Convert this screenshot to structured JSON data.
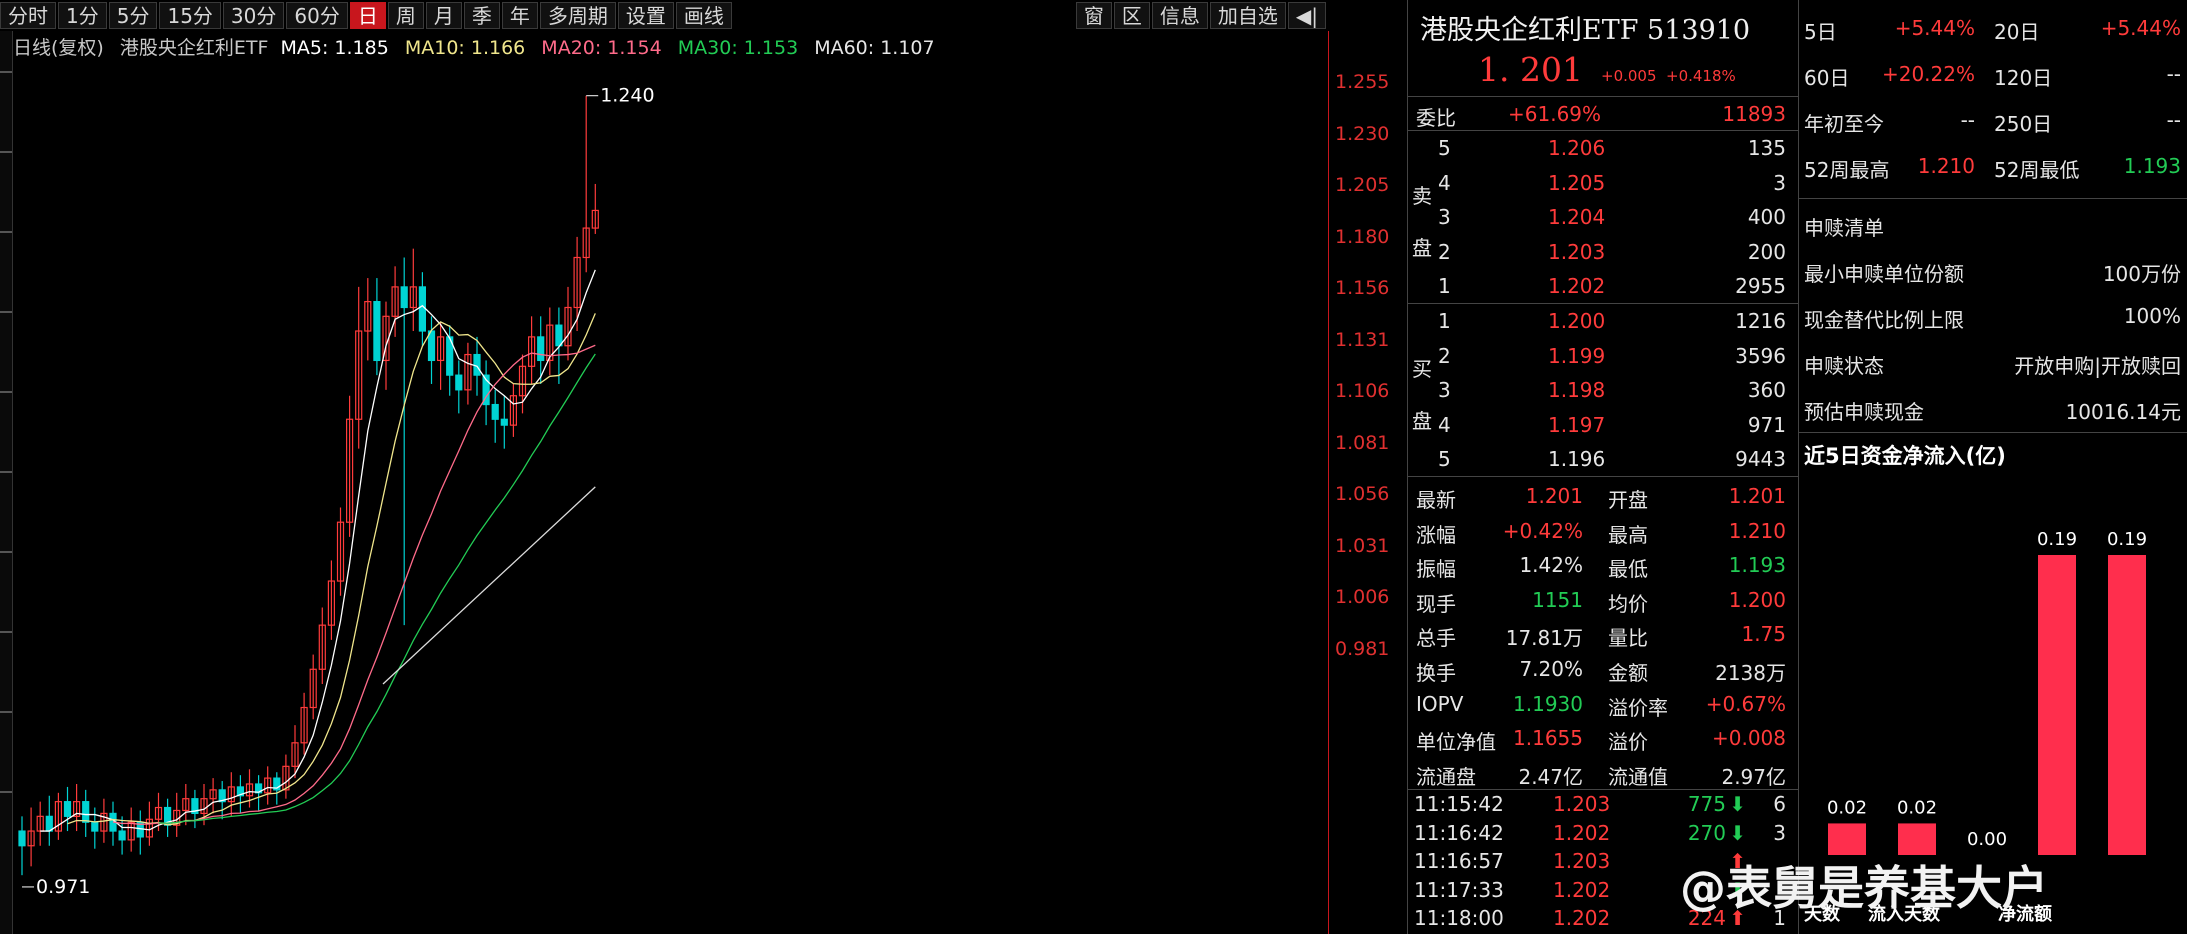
{
  "toolbar": {
    "periods": [
      "分时",
      "1分",
      "5分",
      "15分",
      "30分",
      "60分",
      "日",
      "周",
      "月",
      "季",
      "年",
      "多周期",
      "设置",
      "画线"
    ],
    "active_period": "日",
    "right_items": [
      "窗",
      "区",
      "信息",
      "加自选"
    ]
  },
  "chart": {
    "title": "日线(复权)",
    "name": "港股央企红利ETF",
    "ma5": "MA5: 1.185",
    "ma10": "MA10: 1.166",
    "ma20": "MA20: 1.154",
    "ma30": "MA30: 1.153",
    "ma60": "MA60: 1.107",
    "high_marker": "1.240",
    "low_marker": "0.971",
    "price_ticks": [
      "1.255",
      "1.230",
      "1.205",
      "1.180",
      "1.156",
      "1.131",
      "1.106",
      "1.081",
      "1.056",
      "1.031",
      "1.006",
      "0.981"
    ],
    "colors": {
      "up": "#ff3b3b",
      "down": "#00d4d4",
      "ma5": "#ffffff",
      "ma10": "#f0e68c",
      "ma20": "#ff6b8a",
      "ma30": "#22cc55",
      "ma60": "#dcdcdc"
    }
  },
  "chart_data": {
    "type": "candlestick",
    "title": "港股央企红利ETF 日线(复权)",
    "ylim": [
      0.96,
      1.26
    ],
    "candles": [
      [
        0.99,
        0.985,
        0.995,
        0.975
      ],
      [
        0.985,
        0.99,
        0.998,
        0.978
      ],
      [
        0.99,
        0.995,
        1.0,
        0.985
      ],
      [
        0.995,
        0.99,
        1.002,
        0.985
      ],
      [
        0.99,
        1.0,
        1.003,
        0.987
      ],
      [
        1.0,
        0.995,
        1.005,
        0.99
      ],
      [
        0.995,
        1.0,
        1.006,
        0.99
      ],
      [
        1.0,
        0.993,
        1.004,
        0.988
      ],
      [
        0.993,
        0.99,
        0.998,
        0.984
      ],
      [
        0.99,
        0.996,
        1.001,
        0.986
      ],
      [
        0.996,
        0.99,
        1.0,
        0.985
      ],
      [
        0.99,
        0.987,
        0.995,
        0.982
      ],
      [
        0.987,
        0.993,
        0.998,
        0.983
      ],
      [
        0.993,
        0.988,
        0.997,
        0.982
      ],
      [
        0.988,
        0.994,
        1.0,
        0.985
      ],
      [
        0.994,
        0.998,
        1.003,
        0.99
      ],
      [
        0.998,
        0.992,
        1.001,
        0.988
      ],
      [
        0.992,
        0.997,
        1.003,
        0.988
      ],
      [
        0.997,
        1.001,
        1.006,
        0.992
      ],
      [
        1.001,
        0.996,
        1.004,
        0.991
      ],
      [
        0.996,
        1.001,
        1.006,
        0.992
      ],
      [
        1.001,
        1.004,
        1.008,
        0.996
      ],
      [
        1.004,
        1.0,
        1.007,
        0.994
      ],
      [
        1.0,
        1.005,
        1.01,
        0.995
      ],
      [
        1.005,
        1.002,
        1.009,
        0.996
      ],
      [
        1.002,
        1.006,
        1.011,
        0.998
      ],
      [
        1.006,
        1.003,
        1.009,
        0.997
      ],
      [
        1.003,
        1.008,
        1.012,
        0.999
      ],
      [
        1.008,
        1.004,
        1.01,
        0.999
      ],
      [
        1.004,
        1.012,
        1.016,
        1.001
      ],
      [
        1.012,
        1.02,
        1.026,
        1.008
      ],
      [
        1.02,
        1.032,
        1.037,
        1.016
      ],
      [
        1.032,
        1.045,
        1.05,
        1.028
      ],
      [
        1.045,
        1.06,
        1.066,
        1.04
      ],
      [
        1.06,
        1.075,
        1.082,
        1.055
      ],
      [
        1.075,
        1.095,
        1.1,
        1.07
      ],
      [
        1.095,
        1.13,
        1.138,
        1.09
      ],
      [
        1.13,
        1.16,
        1.175,
        1.12
      ],
      [
        1.16,
        1.17,
        1.178,
        1.15
      ],
      [
        1.17,
        1.15,
        1.178,
        1.145
      ],
      [
        1.15,
        1.165,
        1.17,
        1.14
      ],
      [
        1.165,
        1.175,
        1.182,
        1.158
      ],
      [
        1.175,
        1.168,
        1.185,
        1.06
      ],
      [
        1.168,
        1.175,
        1.188,
        1.16
      ],
      [
        1.175,
        1.16,
        1.18,
        1.155
      ],
      [
        1.16,
        1.15,
        1.165,
        1.142
      ],
      [
        1.15,
        1.158,
        1.163,
        1.14
      ],
      [
        1.158,
        1.145,
        1.162,
        1.138
      ],
      [
        1.145,
        1.14,
        1.15,
        1.132
      ],
      [
        1.14,
        1.152,
        1.156,
        1.135
      ],
      [
        1.152,
        1.145,
        1.158,
        1.138
      ],
      [
        1.145,
        1.135,
        1.15,
        1.128
      ],
      [
        1.135,
        1.13,
        1.14,
        1.122
      ],
      [
        1.13,
        1.128,
        1.138,
        1.12
      ],
      [
        1.128,
        1.138,
        1.142,
        1.124
      ],
      [
        1.138,
        1.148,
        1.152,
        1.132
      ],
      [
        1.148,
        1.158,
        1.165,
        1.142
      ],
      [
        1.158,
        1.15,
        1.165,
        1.142
      ],
      [
        1.15,
        1.162,
        1.168,
        1.145
      ],
      [
        1.162,
        1.155,
        1.168,
        1.142
      ],
      [
        1.155,
        1.168,
        1.175,
        1.15
      ],
      [
        1.168,
        1.185,
        1.192,
        1.16
      ],
      [
        1.185,
        1.195,
        1.24,
        1.18
      ],
      [
        1.195,
        1.201,
        1.21,
        1.193
      ]
    ],
    "ma60_start": [
      1.04,
      1.107
    ]
  },
  "quote": {
    "name": "港股央企红利ETF 513910",
    "price": "1. 201",
    "change": "+0.005",
    "change_pct": "+0.418%",
    "weibi_label": "委比",
    "weibi_value": "+61.69%",
    "weibi_diff": "11893",
    "sell_label": "卖盘",
    "buy_label": "买盘",
    "sell": [
      {
        "lvl": "5",
        "price": "1.206",
        "vol": "135"
      },
      {
        "lvl": "4",
        "price": "1.205",
        "vol": "3"
      },
      {
        "lvl": "3",
        "price": "1.204",
        "vol": "400"
      },
      {
        "lvl": "2",
        "price": "1.203",
        "vol": "200"
      },
      {
        "lvl": "1",
        "price": "1.202",
        "vol": "2955"
      }
    ],
    "buy": [
      {
        "lvl": "1",
        "price": "1.200",
        "vol": "1216"
      },
      {
        "lvl": "2",
        "price": "1.199",
        "vol": "3596"
      },
      {
        "lvl": "3",
        "price": "1.198",
        "vol": "360"
      },
      {
        "lvl": "4",
        "price": "1.197",
        "vol": "971"
      },
      {
        "lvl": "5",
        "price": "1.196",
        "vol": "9443"
      }
    ],
    "stats": [
      {
        "l1": "最新",
        "v1": "1.201",
        "c1": "red",
        "l2": "开盘",
        "v2": "1.201",
        "c2": "red"
      },
      {
        "l1": "涨幅",
        "v1": "+0.42%",
        "c1": "red",
        "l2": "最高",
        "v2": "1.210",
        "c2": "red"
      },
      {
        "l1": "振幅",
        "v1": "1.42%",
        "c1": "white",
        "l2": "最低",
        "v2": "1.193",
        "c2": "green"
      },
      {
        "l1": "现手",
        "v1": "1151",
        "c1": "green",
        "l2": "均价",
        "v2": "1.200",
        "c2": "red"
      },
      {
        "l1": "总手",
        "v1": "17.81万",
        "c1": "white",
        "l2": "量比",
        "v2": "1.75",
        "c2": "red"
      },
      {
        "l1": "换手",
        "v1": "7.20%",
        "c1": "white",
        "l2": "金额",
        "v2": "2138万",
        "c2": "white"
      },
      {
        "l1": "IOPV",
        "v1": "1.1930",
        "c1": "green",
        "l2": "溢价率",
        "v2": "+0.67%",
        "c2": "red"
      },
      {
        "l1": "单位净值",
        "v1": "1.1655",
        "c1": "red",
        "l2": "溢价",
        "v2": "+0.008",
        "c2": "red"
      },
      {
        "l1": "流通盘",
        "v1": "2.47亿",
        "c1": "white",
        "l2": "流通值",
        "v2": "2.97亿",
        "c2": "white"
      }
    ],
    "ticks": [
      {
        "t": "11:15:42",
        "p": "1.203",
        "v": "775",
        "dir": "down",
        "n": "6"
      },
      {
        "t": "11:16:42",
        "p": "1.202",
        "v": "270",
        "dir": "down",
        "n": "3"
      },
      {
        "t": "11:16:57",
        "p": "1.203",
        "v": "",
        "dir": "up",
        "n": ""
      },
      {
        "t": "11:17:33",
        "p": "1.202",
        "v": "",
        "dir": "down",
        "n": ""
      },
      {
        "t": "11:18:00",
        "p": "1.202",
        "v": "224",
        "dir": "up",
        "n": "1"
      }
    ]
  },
  "info": {
    "rows": [
      {
        "l1": "5日",
        "v1": "+5.44%",
        "l2": "20日",
        "v2": "+5.44%"
      },
      {
        "l1": "60日",
        "v1": "+20.22%",
        "l2": "120日",
        "v2": "--"
      },
      {
        "l1": "年初至今",
        "v1": "--",
        "l2": "250日",
        "v2": "--"
      },
      {
        "l1": "52周最高",
        "v1": "1.210",
        "l2": "52周最低",
        "v2": "1.193"
      }
    ],
    "subscribe_title": "申赎清单",
    "subscribe_rows": [
      {
        "label": "最小申赎单位份额",
        "value": "100万份"
      },
      {
        "label": "现金替代比例上限",
        "value": "100%"
      },
      {
        "label": "申赎状态",
        "value": "开放申购|开放赎回"
      },
      {
        "label": "预估申赎现金",
        "value": "10016.14元"
      }
    ],
    "flow_title": "近5日资金净流入(亿)",
    "flow_bars": [
      {
        "value": "0.02",
        "amount": 0.02
      },
      {
        "value": "0.02",
        "amount": 0.02
      },
      {
        "value": "0.00",
        "amount": 0.0
      },
      {
        "value": "0.19",
        "amount": 0.19
      },
      {
        "value": "0.19",
        "amount": 0.19
      }
    ],
    "flow_footer": [
      "天数",
      "流入天数",
      "净流额"
    ]
  },
  "watermark": "@表舅是养基大户"
}
